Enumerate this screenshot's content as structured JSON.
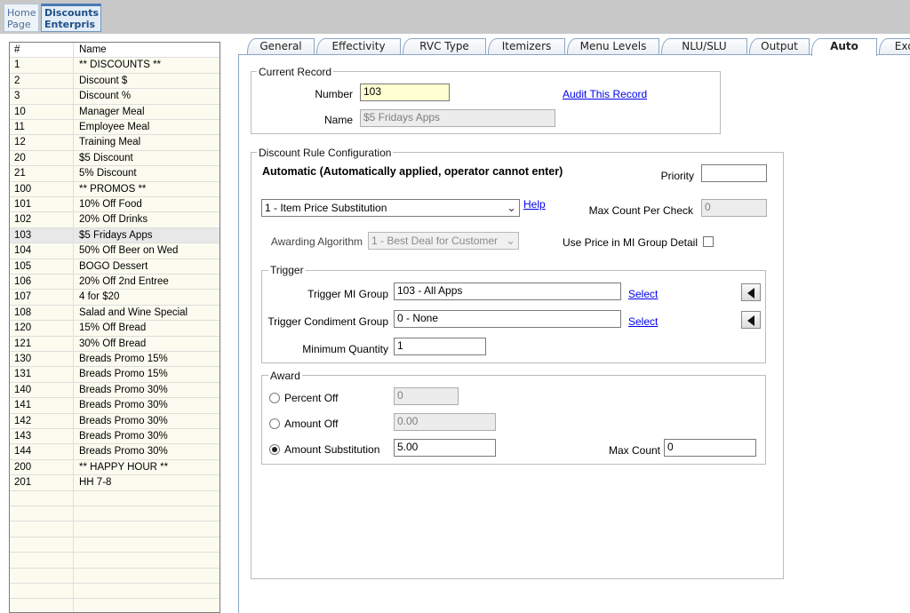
{
  "top_tabs": [
    {
      "line1": "Home",
      "line2": "Page"
    },
    {
      "line1": "Discounts",
      "line2": "Enterpris"
    }
  ],
  "grid": {
    "col_num": "#",
    "col_name": "Name",
    "rows": [
      {
        "num": "1",
        "name": "** DISCOUNTS **"
      },
      {
        "num": "2",
        "name": "Discount $"
      },
      {
        "num": "3",
        "name": "Discount %"
      },
      {
        "num": "10",
        "name": "Manager Meal"
      },
      {
        "num": "11",
        "name": "Employee Meal"
      },
      {
        "num": "12",
        "name": "Training Meal"
      },
      {
        "num": "20",
        "name": "$5 Discount"
      },
      {
        "num": "21",
        "name": "5% Discount"
      },
      {
        "num": "100",
        "name": "** PROMOS **"
      },
      {
        "num": "101",
        "name": "10% Off Food"
      },
      {
        "num": "102",
        "name": "20% Off Drinks"
      },
      {
        "num": "103",
        "name": "$5 Fridays Apps"
      },
      {
        "num": "104",
        "name": "50% Off Beer on Wed"
      },
      {
        "num": "105",
        "name": "BOGO Dessert"
      },
      {
        "num": "106",
        "name": "20% Off 2nd Entree"
      },
      {
        "num": "107",
        "name": "4 for $20"
      },
      {
        "num": "108",
        "name": "Salad and Wine Special"
      },
      {
        "num": "120",
        "name": "15% Off Bread"
      },
      {
        "num": "121",
        "name": "30% Off Bread"
      },
      {
        "num": "130",
        "name": "Breads Promo 15%"
      },
      {
        "num": "131",
        "name": "Breads Promo 15%"
      },
      {
        "num": "140",
        "name": "Breads Promo 30%"
      },
      {
        "num": "141",
        "name": "Breads Promo 30%"
      },
      {
        "num": "142",
        "name": "Breads Promo 30%"
      },
      {
        "num": "143",
        "name": "Breads Promo 30%"
      },
      {
        "num": "144",
        "name": "Breads Promo 30%"
      },
      {
        "num": "200",
        "name": "** HAPPY HOUR **"
      },
      {
        "num": "201",
        "name": "HH 7-8"
      }
    ],
    "selected_num": "103"
  },
  "tabs": [
    "General",
    "Effectivity",
    "RVC Type",
    "Itemizers",
    "Menu Levels",
    "NLU/SLU",
    "Output",
    "Auto",
    "Excl"
  ],
  "active_tab": "Auto",
  "current_record": {
    "legend": "Current Record",
    "number_label": "Number",
    "number_value": "103",
    "name_label": "Name",
    "name_value": "$5 Fridays Apps",
    "audit_link": "Audit This Record"
  },
  "config": {
    "legend": "Discount Rule Configuration",
    "heading": "Automatic (Automatically applied, operator cannot enter)",
    "priority_label": "Priority",
    "priority_value": "",
    "rule_select": "1 - Item Price Substitution",
    "help_link": "Help",
    "max_count_per_check_label": "Max Count Per Check",
    "max_count_per_check_value": "0",
    "awarding_label": "Awarding Algorithm",
    "awarding_value": "1 - Best Deal for Customer",
    "use_price_label": "Use Price in MI Group Detail",
    "use_price_checked": false
  },
  "trigger": {
    "legend": "Trigger",
    "mi_group_label": "Trigger MI Group",
    "mi_group_value": "103 - All Apps",
    "condiment_label": "Trigger Condiment Group",
    "condiment_value": "0 - None",
    "select_label": "Select",
    "min_qty_label": "Minimum Quantity",
    "min_qty_value": "1"
  },
  "award": {
    "legend": "Award",
    "percent_label": "Percent Off",
    "percent_value": "0",
    "amount_label": "Amount Off",
    "amount_value": "0.00",
    "subst_label": "Amount Substitution",
    "subst_value": "5.00",
    "selected": "Amount Substitution",
    "max_count_label": "Max Count",
    "max_count_value": "0"
  }
}
